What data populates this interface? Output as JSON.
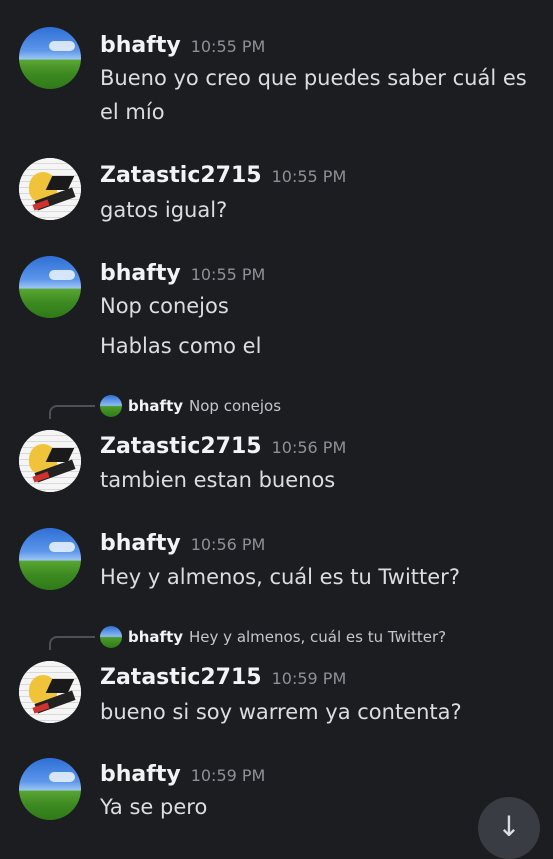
{
  "messages": [
    {
      "author": "bhafty",
      "time": "10:55 PM",
      "lines": [
        "Bueno yo creo que puedes saber cuál es",
        "el mío"
      ]
    },
    {
      "author": "Zatastic2715",
      "time": "10:55 PM",
      "lines": [
        "gatos igual?"
      ]
    },
    {
      "author": "bhafty",
      "time": "10:55 PM",
      "lines": [
        "Nop conejos",
        "Hablas como el"
      ]
    },
    {
      "author": "Zatastic2715",
      "time": "10:56 PM",
      "reply": {
        "author": "bhafty",
        "text": "Nop conejos"
      },
      "lines": [
        "tambien estan buenos"
      ]
    },
    {
      "author": "bhafty",
      "time": "10:56 PM",
      "lines": [
        "Hey y almenos, cuál es tu Twitter?"
      ]
    },
    {
      "author": "Zatastic2715",
      "time": "10:59 PM",
      "reply": {
        "author": "bhafty",
        "text": "Hey y almenos, cuál es tu Twitter?"
      },
      "lines": [
        "bueno si soy warrem ya contenta?"
      ]
    },
    {
      "author": "bhafty",
      "time": "10:59 PM",
      "lines": [
        "Ya se pero"
      ]
    }
  ],
  "scroll_button_glyph": "↓"
}
